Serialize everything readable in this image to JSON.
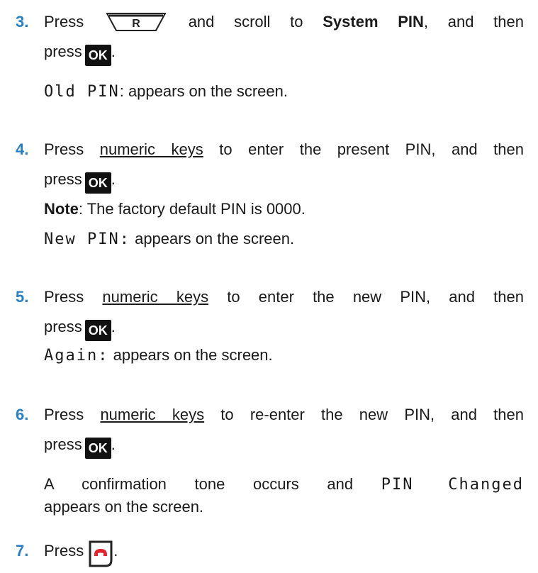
{
  "steps": [
    {
      "number": "3.",
      "l1_pre": "Press",
      "r_key": "R",
      "l1_mid": "and scroll to",
      "l1_bold": "System PIN",
      "l1_post": ", and then",
      "l2_pre": "press",
      "ok": "OK",
      "l2_post": ".",
      "lcd": "Old PIN",
      "lcd_post": ": appears on the screen."
    },
    {
      "number": "4.",
      "l1_pre": "Press",
      "l1_link": "numeric keys",
      "l1_post": "to enter the present PIN, and then",
      "l2_pre": "press",
      "ok": "OK",
      "l2_post": ".",
      "note_label": "Note",
      "note_text": ": The factory default PIN is 0000.",
      "lcd": "New PIN:",
      "lcd_post": " appears on the screen."
    },
    {
      "number": "5.",
      "l1_pre": "Press",
      "l1_link": "numeric keys",
      "l1_post": "to enter the new PIN, and then",
      "l2_pre": "press",
      "ok": "OK",
      "l2_post": ".",
      "lcd": "Again:",
      "lcd_post": " appears on the screen."
    },
    {
      "number": "6.",
      "l1_pre": "Press",
      "l1_link": "numeric keys",
      "l1_post": "to re-enter the new PIN, and then",
      "l2_pre": "press",
      "ok": "OK",
      "l2_post": ".",
      "conf_pre": "A confirmation tone occurs and",
      "lcd": "PIN Changed",
      "conf_post": "appears on the screen."
    },
    {
      "number": "7.",
      "l1_pre": "Press",
      "end_icon": "end-call-key-icon",
      "l1_post": "."
    }
  ],
  "colors": {
    "step_number": "#2a7fc1",
    "end_handset": "#e0252f"
  }
}
